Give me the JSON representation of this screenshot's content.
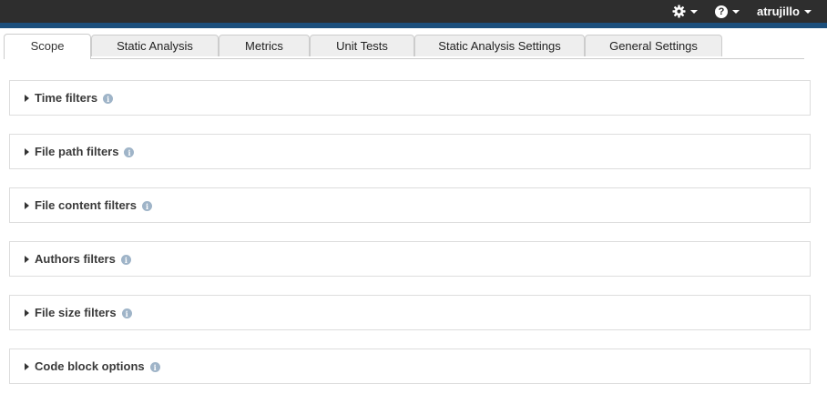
{
  "topbar": {
    "bg_color": "#2e2e2e",
    "accent_color": "#1c4f7c",
    "settings_icon": "gear-icon",
    "help_icon": "help-icon",
    "help_glyph": "?",
    "username": "atrujillo"
  },
  "tabs": [
    {
      "label": "Scope",
      "active": true
    },
    {
      "label": "Static Analysis"
    },
    {
      "label": "Metrics"
    },
    {
      "label": "Unit Tests"
    },
    {
      "label": "Static Analysis Settings"
    },
    {
      "label": "General Settings"
    }
  ],
  "panels": [
    {
      "title": "Time filters",
      "icon": "info-icon"
    },
    {
      "title": "File path filters",
      "icon": "info-icon"
    },
    {
      "title": "File content filters",
      "icon": "info-icon"
    },
    {
      "title": "Authors filters",
      "icon": "info-icon"
    },
    {
      "title": "File size filters",
      "icon": "info-icon"
    },
    {
      "title": "Code block options",
      "icon": "info-icon"
    }
  ],
  "info_glyph": "i"
}
